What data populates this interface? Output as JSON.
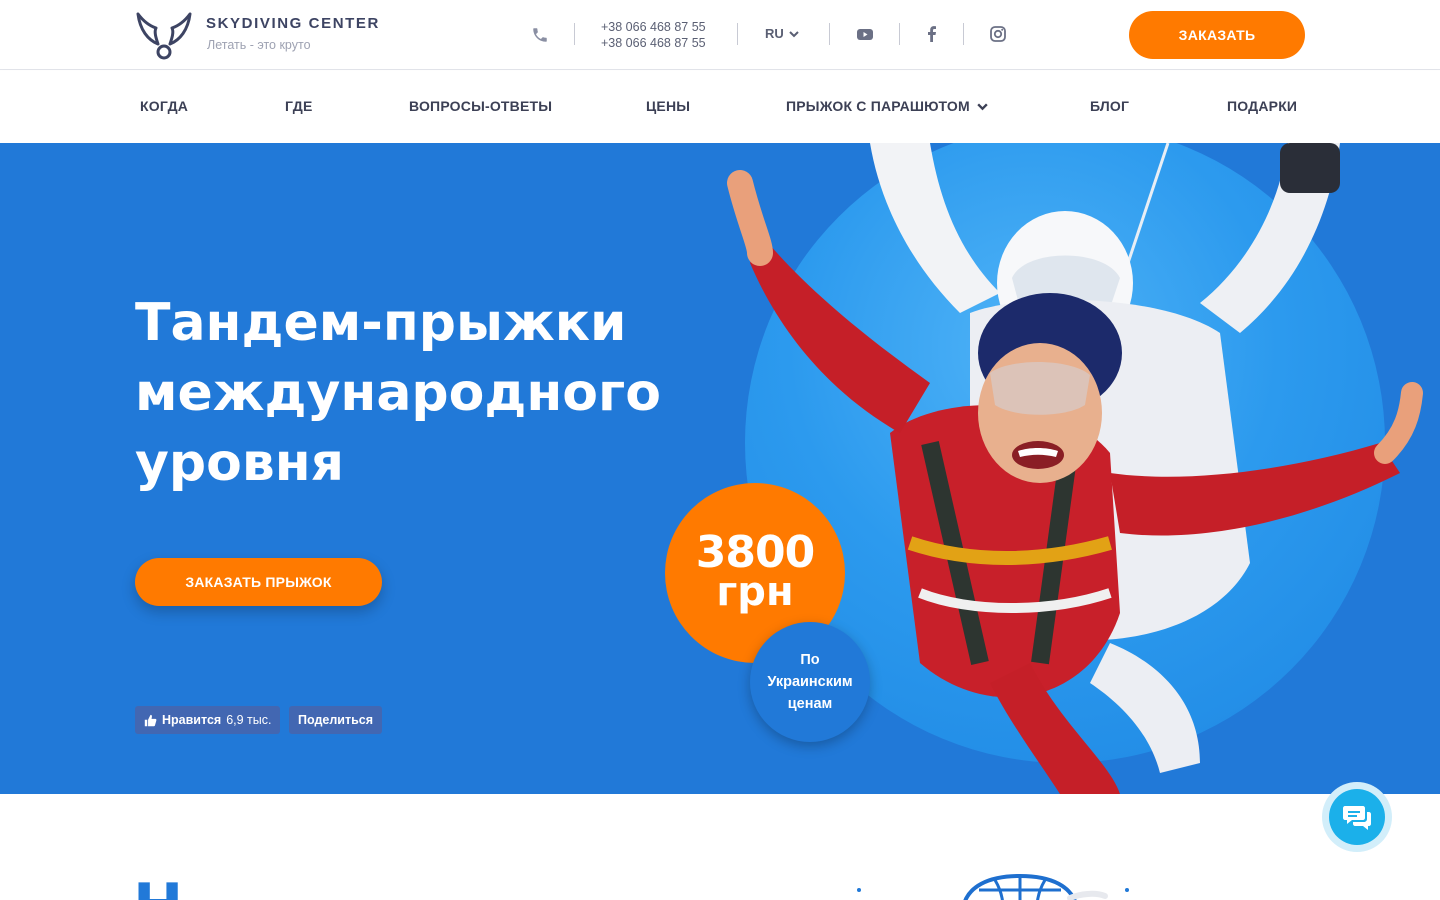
{
  "header": {
    "brand": "SKYDIVING CENTER",
    "tagline": "Летать - это круто",
    "phone_1": "+38 066 468 87 55",
    "phone_2": "+38 066 468 87 55",
    "language": "RU",
    "order_label": "ЗАКАЗАТЬ",
    "social_icons": [
      "youtube-icon",
      "facebook-icon",
      "instagram-icon"
    ]
  },
  "nav": {
    "items": [
      {
        "label": "КОГДА"
      },
      {
        "label": "ГДЕ"
      },
      {
        "label": "ВОПРОСЫ-ОТВЕТЫ"
      },
      {
        "label": "ЦЕНЫ"
      },
      {
        "label": "ПРЫЖОК С ПАРАШЮТОМ",
        "has_dropdown": true
      },
      {
        "label": "БЛОГ"
      },
      {
        "label": "ПОДАРКИ"
      }
    ]
  },
  "hero": {
    "title_lines": [
      "Тандем-прыжки",
      "международного",
      "уровня"
    ],
    "cta_label": "ЗАКАЗАТЬ ПРЫЖОК",
    "price_value": "3800",
    "price_currency": "грн",
    "price_note_lines": [
      "По",
      "Украинским",
      "ценам"
    ],
    "fb_like_label": "Нравится",
    "fb_like_count": "6,9 тыс.",
    "fb_share_label": "Поделиться"
  },
  "below": {
    "heading_start": "Н"
  },
  "colors": {
    "accent_orange": "#ff7a00",
    "hero_blue": "#2179d8",
    "text_dark": "#3c4055",
    "facebook_blue": "#4267b2",
    "chat_cyan": "#1bb0ea"
  }
}
